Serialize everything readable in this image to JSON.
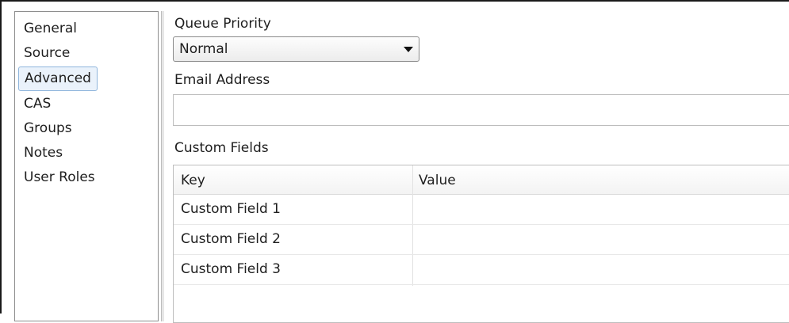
{
  "sidebar": {
    "items": [
      {
        "label": "General",
        "selected": false
      },
      {
        "label": "Source",
        "selected": false
      },
      {
        "label": "Advanced",
        "selected": true
      },
      {
        "label": "CAS",
        "selected": false
      },
      {
        "label": "Groups",
        "selected": false
      },
      {
        "label": "Notes",
        "selected": false
      },
      {
        "label": "User Roles",
        "selected": false
      }
    ]
  },
  "queue_priority": {
    "label": "Queue Priority",
    "selected_value": "Normal"
  },
  "email": {
    "label": "Email Address",
    "value": "",
    "placeholder": ""
  },
  "custom_fields": {
    "label": "Custom Fields",
    "columns": [
      "Key",
      "Value"
    ],
    "rows": [
      {
        "key": "Custom Field 1",
        "value": ""
      },
      {
        "key": "Custom Field 2",
        "value": ""
      },
      {
        "key": "Custom Field 3",
        "value": ""
      }
    ]
  },
  "colors": {
    "selection_fill": "#eaf2fb",
    "selection_border": "#8fb5dc",
    "border_gray": "#bdbdbd"
  }
}
